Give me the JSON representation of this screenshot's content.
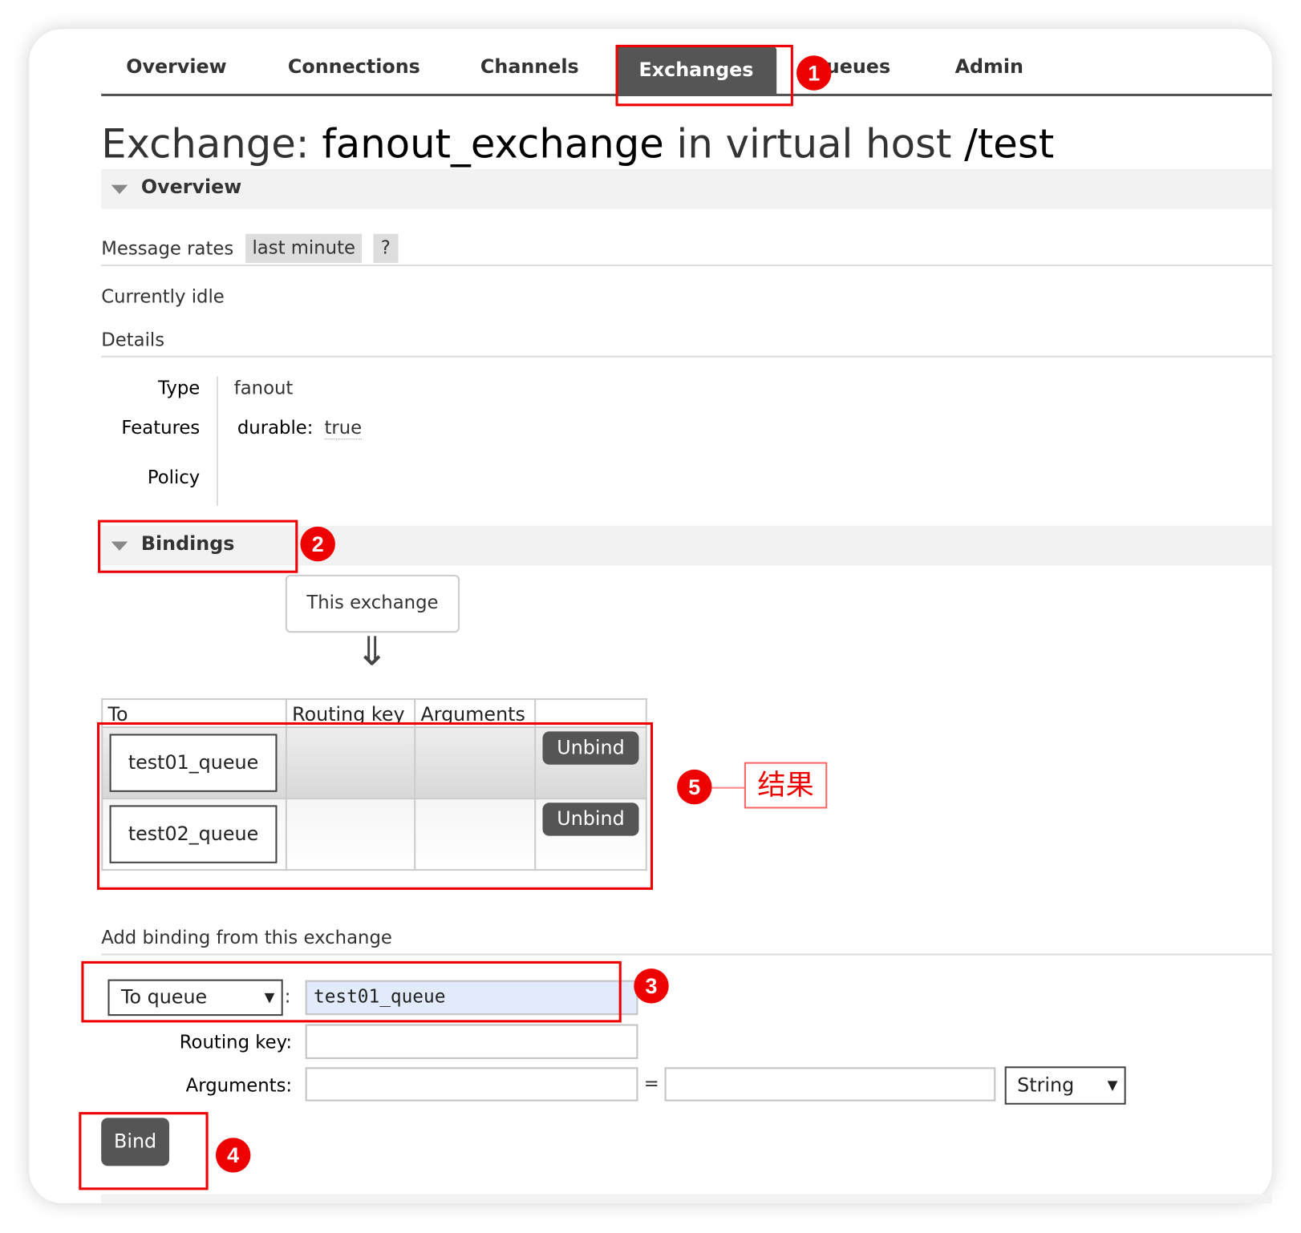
{
  "nav": {
    "tabs": [
      "Overview",
      "Connections",
      "Channels",
      "Exchanges",
      "Queues",
      "Admin"
    ],
    "active": "Exchanges"
  },
  "title": {
    "prefix": "Exchange:",
    "name": "fanout_exchange",
    "middle": "in virtual host",
    "vhost": "/test"
  },
  "overview": {
    "section_label": "Overview",
    "message_rates_label": "Message rates",
    "rates_period": "last minute",
    "help": "?",
    "status": "Currently idle",
    "details_label": "Details",
    "details": {
      "type_label": "Type",
      "type_value": "fanout",
      "features_label": "Features",
      "features_key": "durable:",
      "features_value": "true",
      "policy_label": "Policy"
    }
  },
  "bindings": {
    "section_label": "Bindings",
    "source_box": "This exchange",
    "arrow": "⇓",
    "columns": [
      "To",
      "Routing key",
      "Arguments",
      ""
    ],
    "rows": [
      {
        "to": "test01_queue",
        "routing_key": "",
        "arguments": "",
        "action": "Unbind"
      },
      {
        "to": "test02_queue",
        "routing_key": "",
        "arguments": "",
        "action": "Unbind"
      }
    ]
  },
  "add_binding": {
    "heading": "Add binding from this exchange",
    "destination_type": "To queue",
    "destination_value": "test01_queue",
    "routing_key_label": "Routing key:",
    "routing_key_value": "",
    "arguments_label": "Arguments:",
    "arg_key": "",
    "equals": "=",
    "arg_value": "",
    "arg_type": "String",
    "bind_label": "Bind"
  },
  "annotations": {
    "badges": [
      "1",
      "2",
      "3",
      "4",
      "5"
    ],
    "result_label": "结果",
    "color": "#e00000"
  }
}
